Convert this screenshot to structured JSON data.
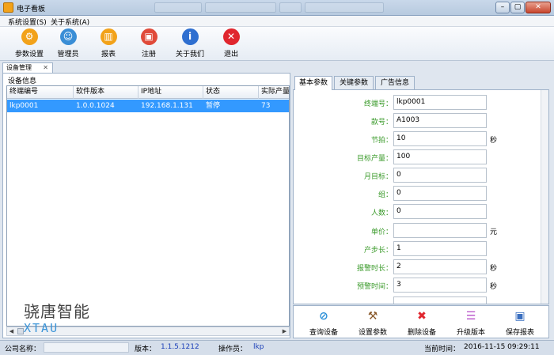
{
  "window": {
    "title": "电子看板"
  },
  "menu": {
    "items": [
      "系统设置(S)",
      "关于系统(A)"
    ]
  },
  "toolbar": [
    {
      "label": "参数设置",
      "icon": "settings-icon",
      "color": "#f2a21a",
      "glyph": "⚙"
    },
    {
      "label": "管理员",
      "icon": "user-icon",
      "color": "#3a8ed6",
      "glyph": "☺"
    },
    {
      "label": "报表",
      "icon": "chart-icon",
      "color": "#f2a21a",
      "glyph": "▥"
    },
    {
      "label": "注册",
      "icon": "lock-icon",
      "color": "#e04a3a",
      "glyph": "🔒"
    },
    {
      "label": "关于我们",
      "icon": "info-icon",
      "color": "#2f6fd0",
      "glyph": "i"
    },
    {
      "label": "退出",
      "icon": "close-icon",
      "color": "#e0262e",
      "glyph": "✕"
    }
  ],
  "doc_tab": {
    "label": "设备管理",
    "close": "✕"
  },
  "left": {
    "group_title": "设备信息",
    "columns": [
      "终端编号",
      "软件版本",
      "IP地址",
      "状态",
      "实际产量"
    ],
    "rows": [
      [
        "lkp0001",
        "1.0.0.1024",
        "192.168.1.131",
        "暂停",
        "73"
      ]
    ]
  },
  "brand": {
    "name": "骁唐智能",
    "sub": "XTAU"
  },
  "right": {
    "tabs": [
      "基本参数",
      "关键参数",
      "广告信息"
    ],
    "fields": [
      {
        "label": "终端号：",
        "value": "lkp0001",
        "unit": ""
      },
      {
        "label": "款号：",
        "value": "A1003",
        "unit": ""
      },
      {
        "label": "节拍：",
        "value": "10",
        "unit": "秒"
      },
      {
        "label": "目标产量：",
        "value": "100",
        "unit": ""
      },
      {
        "label": "月目标：",
        "value": "0",
        "unit": ""
      },
      {
        "label": "组：",
        "value": "0",
        "unit": ""
      },
      {
        "label": "人数：",
        "value": "0",
        "unit": ""
      },
      {
        "label": "单价：",
        "value": "",
        "unit": "元"
      },
      {
        "label": "产步长：",
        "value": "1",
        "unit": ""
      },
      {
        "label": "报警时长：",
        "value": "2",
        "unit": "秒"
      },
      {
        "label": "预警时间：",
        "value": "3",
        "unit": "秒"
      }
    ],
    "actions": [
      {
        "label": "查询设备",
        "icon": "search-icon",
        "glyph": "⊘",
        "color": "#2a8fd8"
      },
      {
        "label": "设置参数",
        "icon": "hammer-icon",
        "glyph": "⚒",
        "color": "#8a5a2b"
      },
      {
        "label": "删除设备",
        "icon": "delete-icon",
        "glyph": "✖",
        "color": "#e0262e"
      },
      {
        "label": "升级版本",
        "icon": "upgrade-icon",
        "glyph": "☰",
        "color": "#b64fc8"
      },
      {
        "label": "保存报表",
        "icon": "save-icon",
        "glyph": "💾",
        "color": "#3a6fc0"
      }
    ]
  },
  "status": {
    "company_label": "公司名称：",
    "version_label": "版本：",
    "version": "1.1.5.1212",
    "operator_label": "操作员：",
    "operator": "lkp",
    "time_label": "当前时间：",
    "time": "2016-11-15 09:29:11"
  }
}
